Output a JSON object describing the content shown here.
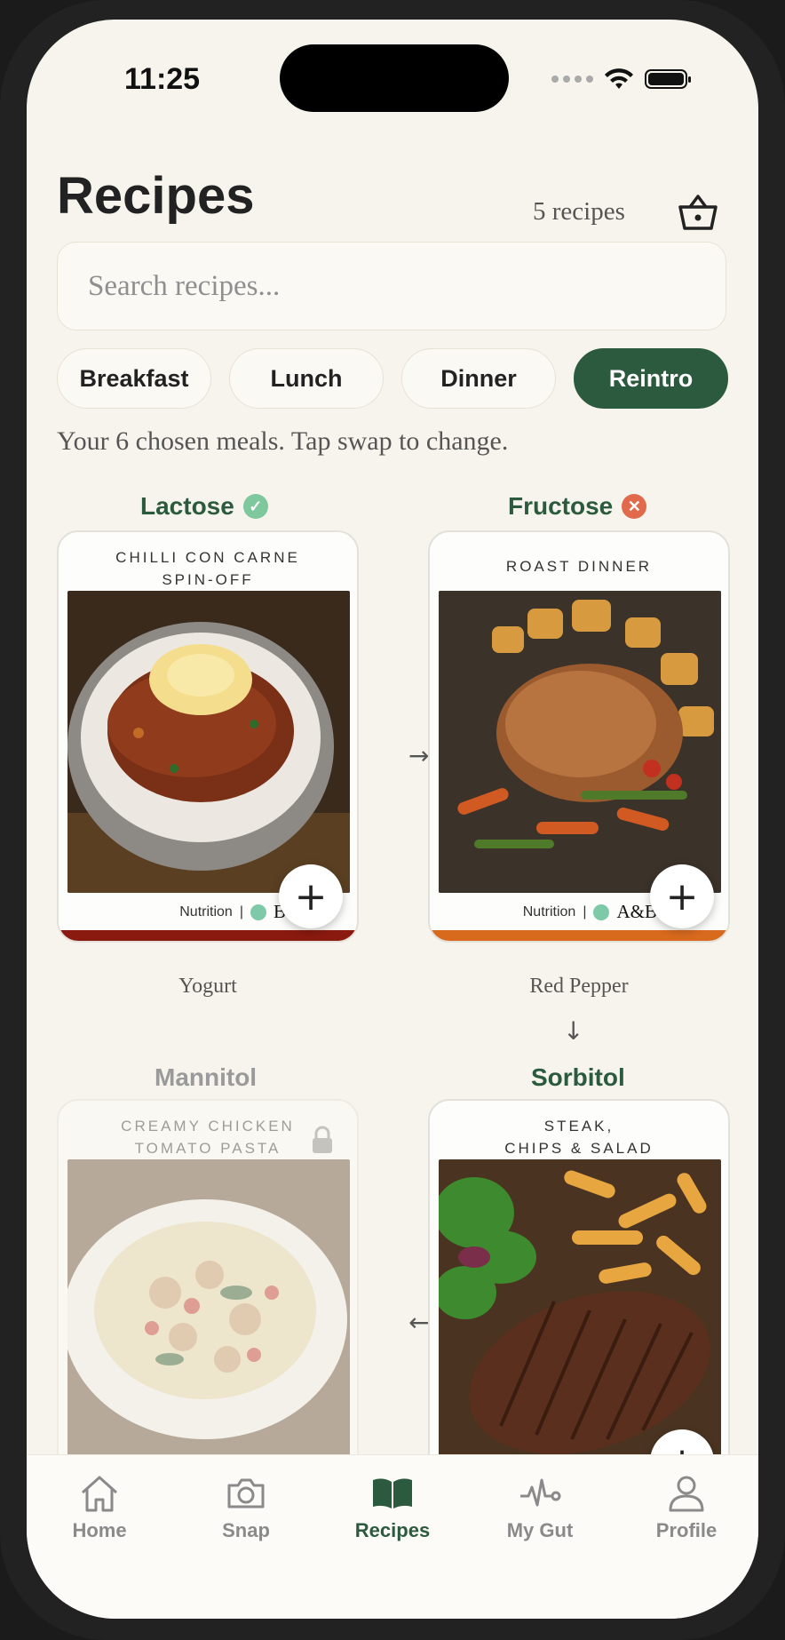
{
  "status": {
    "time": "11:25"
  },
  "header": {
    "title": "Recipes",
    "count": "5 recipes"
  },
  "search": {
    "placeholder": "Search recipes..."
  },
  "chips": [
    "Breakfast",
    "Lunch",
    "Dinner",
    "Reintro"
  ],
  "active_chip": "Reintro",
  "hint": "Your 6 chosen meals. Tap swap to change.",
  "slots": [
    {
      "title": "Lactose",
      "status": "passed",
      "recipe": "CHILLI CON CARNE\nSPIN-OFF",
      "nutrition_label": "Nutrition",
      "grade": "B",
      "swap": "Yogurt",
      "stripe_color": "#8a1a0f"
    },
    {
      "title": "Fructose",
      "status": "failed",
      "recipe": "ROAST DINNER",
      "nutrition_label": "Nutrition",
      "grade": "A&B",
      "swap": "Red Pepper",
      "stripe_color": "#d86a1e"
    },
    {
      "title": "Mannitol",
      "status": "locked",
      "recipe": "CREAMY CHICKEN\nTOMATO PASTA"
    },
    {
      "title": "Sorbitol",
      "status": "current",
      "recipe": "STEAK,\nCHIPS & SALAD"
    }
  ],
  "tabbar": [
    {
      "label": "Home",
      "icon": "home-icon"
    },
    {
      "label": "Snap",
      "icon": "camera-icon"
    },
    {
      "label": "Recipes",
      "icon": "book-icon"
    },
    {
      "label": "My Gut",
      "icon": "pulse-icon"
    },
    {
      "label": "Profile",
      "icon": "person-icon"
    }
  ],
  "colors": {
    "accent": "#2c5a3e",
    "background": "#f6f4ec",
    "ok": "#7fc79d",
    "bad": "#e26a4c"
  }
}
